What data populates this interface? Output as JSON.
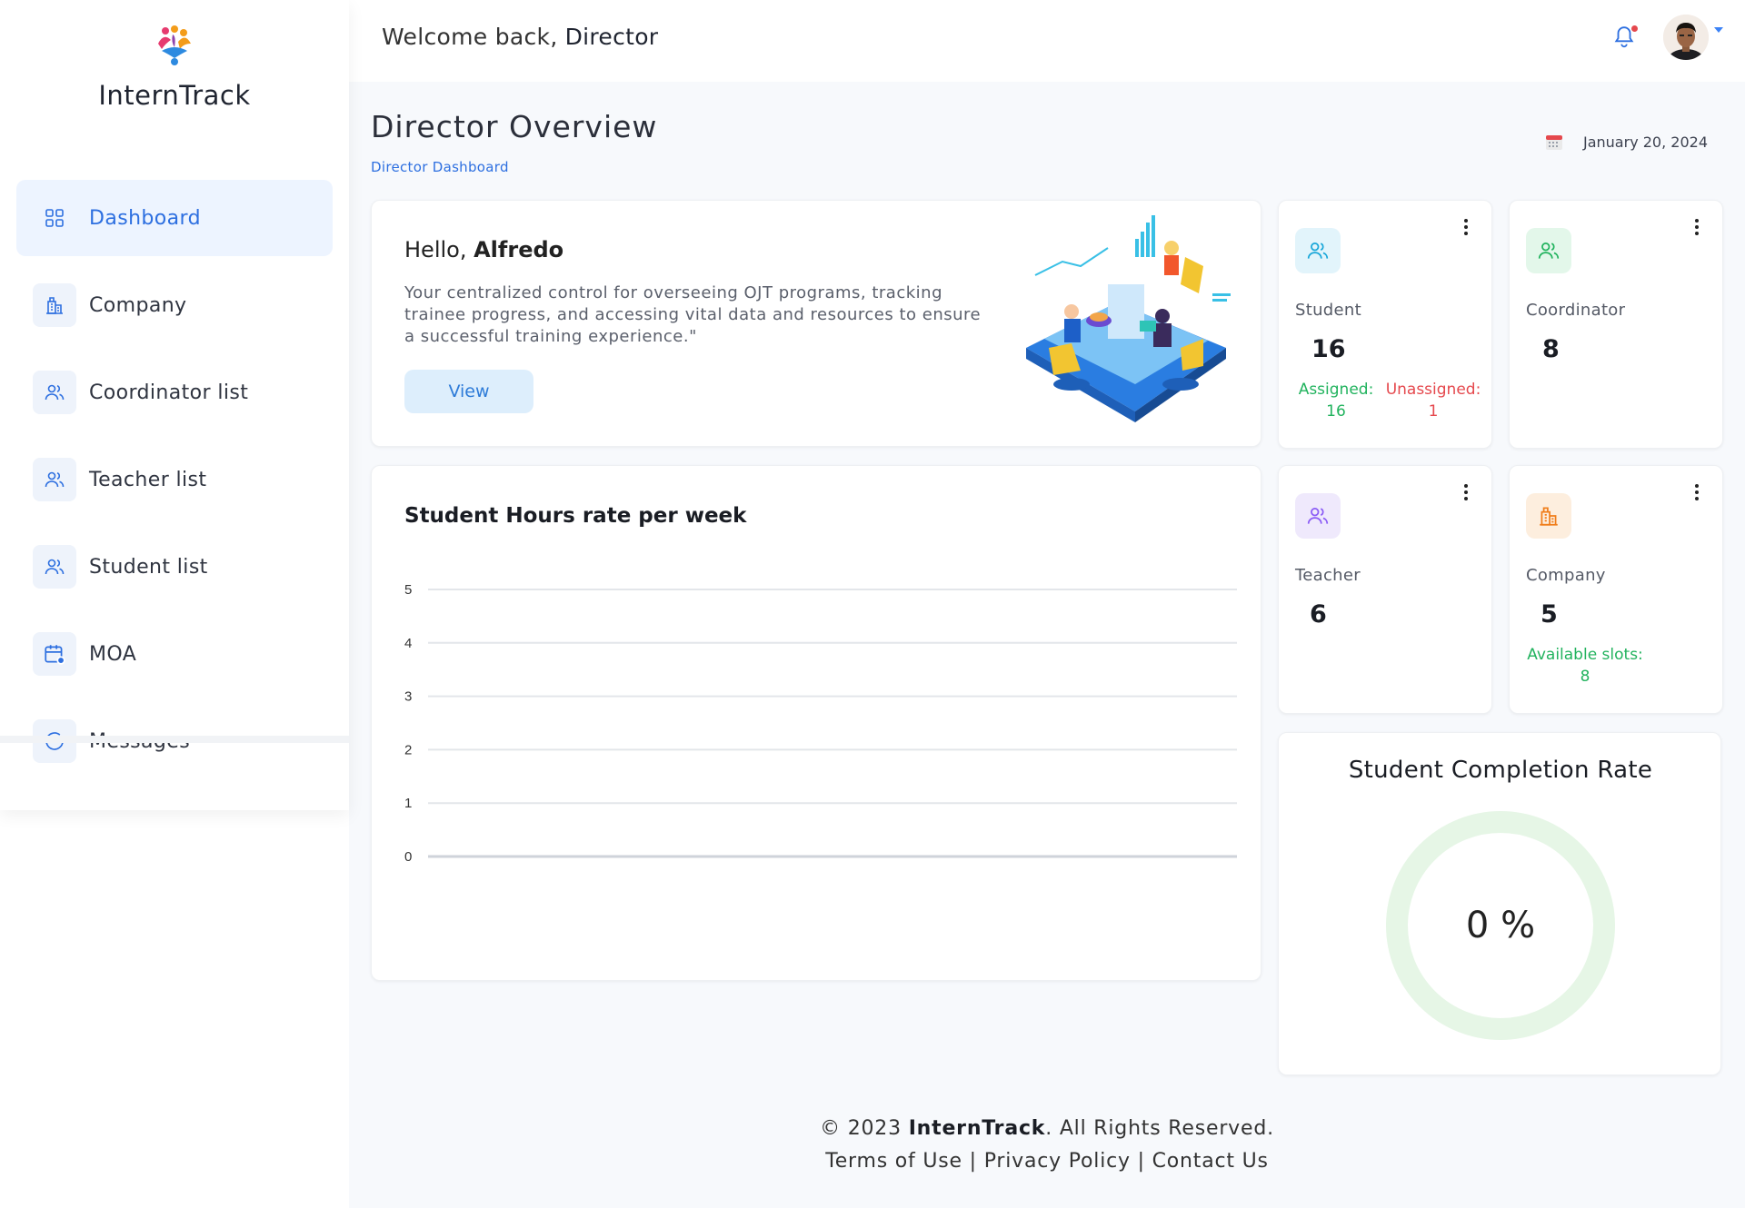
{
  "app": {
    "name": "InternTrack"
  },
  "header": {
    "welcome_prefix": "Welcome back,",
    "role": "Director"
  },
  "sidebar": {
    "items": [
      {
        "label": "Dashboard",
        "icon": "dashboard-icon",
        "active": true
      },
      {
        "label": "Company",
        "icon": "building-icon"
      },
      {
        "label": "Coordinator list",
        "icon": "users-icon"
      },
      {
        "label": "Teacher list",
        "icon": "users-icon"
      },
      {
        "label": "Student list",
        "icon": "users-icon"
      },
      {
        "label": "MOA",
        "icon": "calendar-icon"
      },
      {
        "label": "Messages",
        "icon": "message-icon"
      }
    ]
  },
  "page": {
    "title": "Director Overview",
    "breadcrumb": "Director Dashboard",
    "date": "January 20, 2024"
  },
  "hello": {
    "greeting": "Hello,",
    "name": "Alfredo",
    "text": "Your centralized control for overseeing OJT programs, tracking trainee progress, and accessing vital data and resources to ensure a successful training experience.\"",
    "button": "View"
  },
  "stats": {
    "student": {
      "label": "Student",
      "value": "16",
      "assigned_label": "Assigned:",
      "assigned": "16",
      "unassigned_label": "Unassigned:",
      "unassigned": "1",
      "color": "#1aa7d9"
    },
    "coordinator": {
      "label": "Coordinator",
      "value": "8",
      "color": "#22b35e"
    },
    "teacher": {
      "label": "Teacher",
      "value": "6",
      "color": "#8b5cf6"
    },
    "company": {
      "label": "Company",
      "value": "5",
      "slots_label": "Available slots:",
      "slots": "8",
      "color": "#f07d1a"
    }
  },
  "chart_data": {
    "type": "line",
    "title": "Student Hours rate per week",
    "categories": [],
    "series": [],
    "ylim": [
      0,
      5
    ],
    "yticks": [
      "5",
      "4",
      "3",
      "2",
      "1",
      "0"
    ],
    "grid": true
  },
  "completion": {
    "title": "Student Completion Rate",
    "value": "0 %",
    "ring_color": "#e6f6e6"
  },
  "footer": {
    "prefix": "© 2023 ",
    "brand": "InternTrack",
    "suffix": ". All Rights Reserved.",
    "terms": "Terms of Use",
    "privacy": "Privacy Policy",
    "contact": "Contact Us",
    "separator": " | "
  }
}
